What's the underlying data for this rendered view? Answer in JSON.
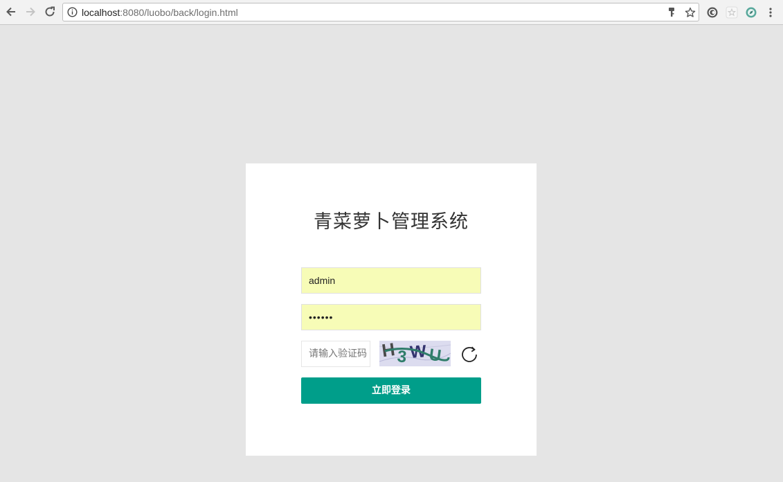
{
  "browser": {
    "url_host": "localhost",
    "url_rest": ":8080/luobo/back/login.html",
    "icons": [
      "back-icon",
      "forward-icon",
      "reload-icon",
      "info-icon",
      "key-icon",
      "star-icon",
      "extension-icon",
      "extension-icon",
      "extension-icon",
      "menu-icon"
    ]
  },
  "login": {
    "title": "青菜萝卜管理系统",
    "username_value": "admin",
    "password_value": "••••••",
    "captcha_placeholder": "请输入验证码",
    "captcha_text": "H3WU",
    "submit_label": "立即登录"
  },
  "colors": {
    "background": "#e5e5e5",
    "card": "#ffffff",
    "autofill": "#f7fcb7",
    "accent": "#009e8a"
  }
}
